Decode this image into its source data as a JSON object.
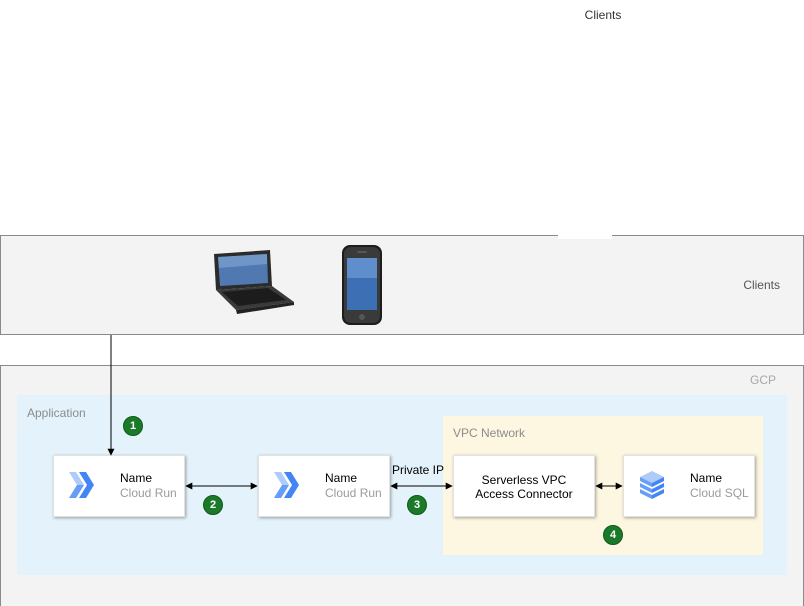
{
  "clients": {
    "top_label": "Clients",
    "band_label": "Clients"
  },
  "gcp": {
    "label": "GCP"
  },
  "application": {
    "label": "Application"
  },
  "vpc": {
    "label": "VPC Network"
  },
  "nodes": [
    {
      "title": "Name",
      "subtitle": "Cloud Run",
      "icon": "cloud-run-icon"
    },
    {
      "title": "Name",
      "subtitle": "Cloud Run",
      "icon": "cloud-run-icon"
    },
    {
      "title": "Serverless VPC",
      "subtitle": "Access Connector"
    },
    {
      "title": "Name",
      "subtitle": "Cloud SQL",
      "icon": "cloud-sql-icon"
    }
  ],
  "edges": {
    "private_ip_label": "Private IP"
  },
  "badges": [
    "1",
    "2",
    "3",
    "4"
  ],
  "colors": {
    "badge_green": "#1b7a2a",
    "application_bg": "#e4f2fb",
    "vpc_bg": "#fdf6e1",
    "band_bg": "#f3f3f3",
    "cloud_run_blue": "#4285f4"
  }
}
